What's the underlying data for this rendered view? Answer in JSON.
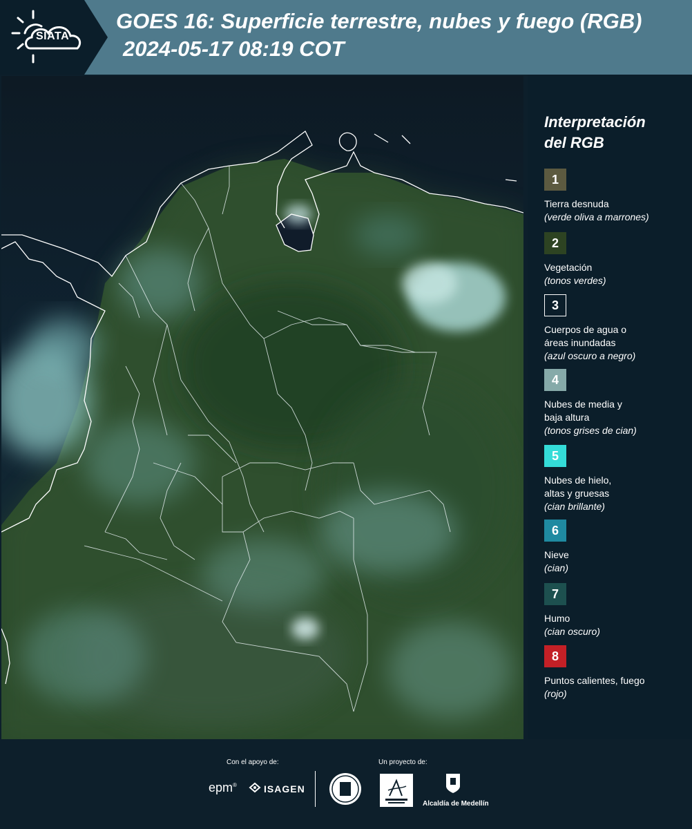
{
  "header": {
    "logo_text": "SIATA",
    "title": "GOES 16: Superficie terrestre, nubes y fuego (RGB)",
    "timestamp": "2024-05-17 08:19 COT"
  },
  "map": {
    "satellite": "GOES 16",
    "product": "RGB"
  },
  "legend": {
    "title_line1": "Interpretación",
    "title_line2": "del RGB",
    "items": [
      {
        "number": "1",
        "color": "#5c5a40",
        "lines": [
          "Tierra desnuda"
        ],
        "sub": "(verde oliva a marrones)"
      },
      {
        "number": "2",
        "color": "#2d4322",
        "lines": [
          "Vegetación"
        ],
        "sub": "(tonos verdes)"
      },
      {
        "number": "3",
        "color": "#0b1e2a",
        "lines": [
          "Cuerpos de agua o",
          "áreas inundadas"
        ],
        "sub": "(azul oscuro a negro)"
      },
      {
        "number": "4",
        "color": "#86aaa9",
        "lines": [
          "Nubes de media y",
          "baja altura"
        ],
        "sub": "(tonos grises de cian)"
      },
      {
        "number": "5",
        "color": "#34dcd8",
        "lines": [
          "Nubes de hielo,",
          "altas y gruesas"
        ],
        "sub": "(cian brillante)"
      },
      {
        "number": "6",
        "color": "#1f8aa1",
        "lines": [
          "Nieve"
        ],
        "sub": "(cian)"
      },
      {
        "number": "7",
        "color": "#1d504f",
        "lines": [
          "Humo"
        ],
        "sub": "(cian oscuro)"
      },
      {
        "number": "8",
        "color": "#c42026",
        "lines": [
          "Puntos calientes, fuego"
        ],
        "sub": "(rojo)"
      }
    ]
  },
  "footer": {
    "support_label": "Con el apoyo de:",
    "project_label": "Un proyecto de:",
    "epm": "epm",
    "isagen": "ISAGEN",
    "alcaldia": "Alcaldía de Medellín"
  }
}
